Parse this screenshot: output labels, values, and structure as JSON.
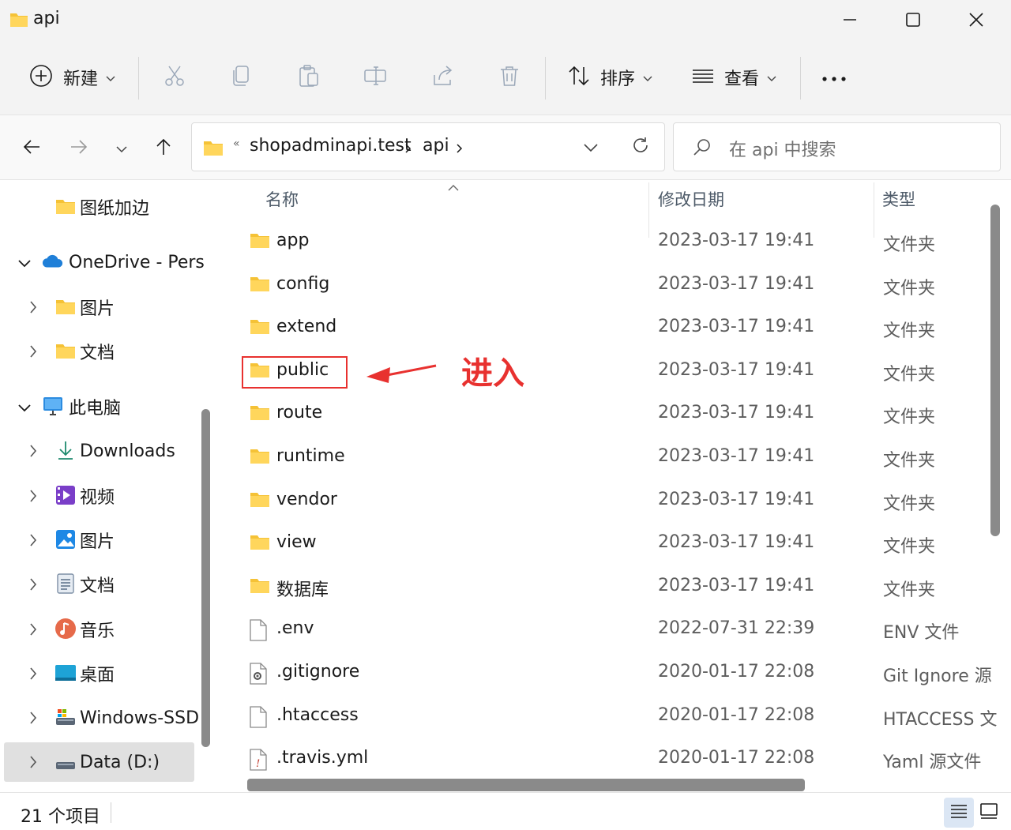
{
  "window": {
    "title": "api",
    "minimize_label": "minimize",
    "maximize_label": "maximize",
    "close_label": "close"
  },
  "toolbar": {
    "new_label": "新建",
    "sort_label": "排序",
    "view_label": "查看",
    "more_label": "•••"
  },
  "address": {
    "overflow": "«",
    "crumbs": [
      "shopadminapi.test",
      "api"
    ]
  },
  "search": {
    "placeholder": "在 api 中搜索"
  },
  "sidebar": {
    "items": [
      {
        "label": "图纸加边",
        "icon": "folder-icon"
      },
      {
        "label": "OneDrive - Pers",
        "icon": "onedrive-icon"
      },
      {
        "label": "图片",
        "icon": "folder-icon"
      },
      {
        "label": "文档",
        "icon": "folder-icon"
      },
      {
        "label": "此电脑",
        "icon": "computer-icon"
      },
      {
        "label": "Downloads",
        "icon": "download-icon"
      },
      {
        "label": "视频",
        "icon": "video-icon"
      },
      {
        "label": "图片",
        "icon": "pictures-icon"
      },
      {
        "label": "文档",
        "icon": "documents-icon"
      },
      {
        "label": "音乐",
        "icon": "music-icon"
      },
      {
        "label": "桌面",
        "icon": "desktop-icon"
      },
      {
        "label": "Windows-SSD",
        "icon": "drive-icon"
      },
      {
        "label": "Data (D:)",
        "icon": "drive-icon"
      }
    ]
  },
  "columns": {
    "name": "名称",
    "date": "修改日期",
    "type": "类型"
  },
  "files": [
    {
      "name": "app",
      "date": "2023-03-17 19:41",
      "type": "文件夹",
      "kind": "folder"
    },
    {
      "name": "config",
      "date": "2023-03-17 19:41",
      "type": "文件夹",
      "kind": "folder"
    },
    {
      "name": "extend",
      "date": "2023-03-17 19:41",
      "type": "文件夹",
      "kind": "folder"
    },
    {
      "name": "public",
      "date": "2023-03-17 19:41",
      "type": "文件夹",
      "kind": "folder"
    },
    {
      "name": "route",
      "date": "2023-03-17 19:41",
      "type": "文件夹",
      "kind": "folder"
    },
    {
      "name": "runtime",
      "date": "2023-03-17 19:41",
      "type": "文件夹",
      "kind": "folder"
    },
    {
      "name": "vendor",
      "date": "2023-03-17 19:41",
      "type": "文件夹",
      "kind": "folder"
    },
    {
      "name": "view",
      "date": "2023-03-17 19:41",
      "type": "文件夹",
      "kind": "folder"
    },
    {
      "name": "数据库",
      "date": "2023-03-17 19:41",
      "type": "文件夹",
      "kind": "folder"
    },
    {
      "name": ".env",
      "date": "2022-07-31 22:39",
      "type": "ENV 文件",
      "kind": "file"
    },
    {
      "name": ".gitignore",
      "date": "2020-01-17 22:08",
      "type": "Git Ignore 源",
      "kind": "gear-file"
    },
    {
      "name": ".htaccess",
      "date": "2020-01-17 22:08",
      "type": "HTACCESS 文",
      "kind": "file"
    },
    {
      "name": ".travis.yml",
      "date": "2020-01-17 22:08",
      "type": "Yaml 源文件",
      "kind": "yaml-file"
    }
  ],
  "annotation": {
    "text": "进入",
    "color": "#e8312f"
  },
  "status": {
    "count": "21 个项目"
  },
  "colors": {
    "folder": "#f5c236",
    "accent": "#0067c0"
  }
}
